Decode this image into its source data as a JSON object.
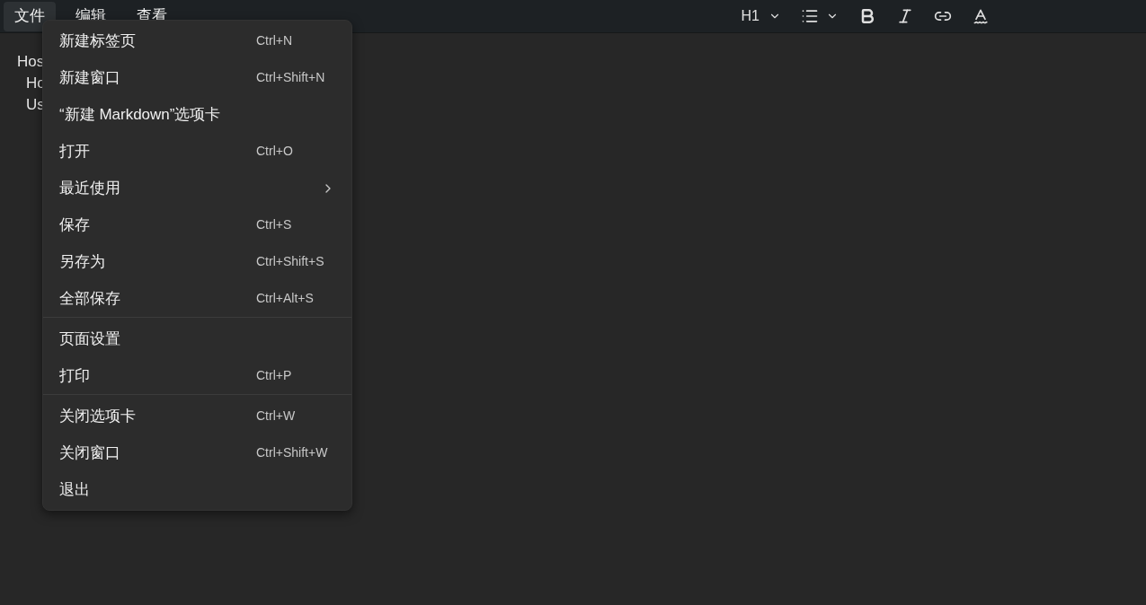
{
  "menu_bar": [
    {
      "label": "文件",
      "selected": true
    },
    {
      "label": "编辑",
      "selected": false
    },
    {
      "label": "查看",
      "selected": false
    }
  ],
  "toolbar": {
    "heading": "H1"
  },
  "editor": {
    "lines": [
      {
        "text": "Hos",
        "children": [
          {
            "text": "Ho"
          },
          {
            "text": "Us"
          }
        ]
      }
    ]
  },
  "file_menu": {
    "groups": [
      [
        {
          "kind": "item",
          "label": "新建标签页",
          "shortcut": "Ctrl+N"
        },
        {
          "kind": "item",
          "label": "新建窗口",
          "shortcut": "Ctrl+Shift+N"
        },
        {
          "kind": "item",
          "label": "“新建 Markdown”选项卡"
        },
        {
          "kind": "item",
          "label": "打开",
          "shortcut": "Ctrl+O"
        },
        {
          "kind": "submenu",
          "label": "最近使用"
        },
        {
          "kind": "item",
          "label": "保存",
          "shortcut": "Ctrl+S"
        },
        {
          "kind": "item",
          "label": "另存为",
          "shortcut": "Ctrl+Shift+S"
        },
        {
          "kind": "item",
          "label": "全部保存",
          "shortcut": "Ctrl+Alt+S"
        }
      ],
      [
        {
          "kind": "item",
          "label": "页面设置"
        },
        {
          "kind": "item",
          "label": "打印",
          "shortcut": "Ctrl+P"
        }
      ],
      [
        {
          "kind": "item",
          "label": "关闭选项卡",
          "shortcut": "Ctrl+W"
        },
        {
          "kind": "item",
          "label": "关闭窗口",
          "shortcut": "Ctrl+Shift+W"
        },
        {
          "kind": "item",
          "label": "退出"
        }
      ]
    ]
  }
}
